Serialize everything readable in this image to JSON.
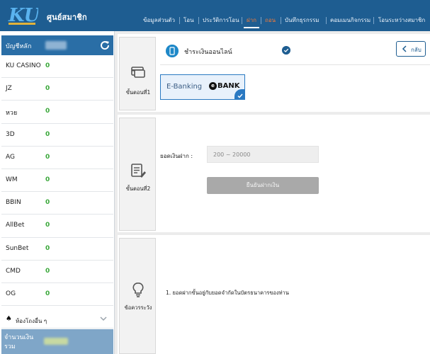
{
  "header": {
    "logo_text": "KU",
    "site_title": "ศูนย์สมาชิก",
    "nav": [
      {
        "label": "ข้อมูลส่วนตัว",
        "active": false
      },
      {
        "label": "โอน",
        "active": false
      },
      {
        "label": "ประวัติการโอน",
        "active": false
      },
      {
        "label": "ฝาก",
        "active": true
      },
      {
        "label": "ถอน",
        "active": false
      },
      {
        "label": "บันทึกธุรกรรม",
        "active": false
      },
      {
        "label": "คอมเมนกิจกรรม",
        "active": false
      },
      {
        "label": "โอนระหว่างสมาชิก",
        "active": false
      }
    ]
  },
  "sidebar": {
    "title": "บัญชีหลัก",
    "accounts": [
      {
        "name": "KU CASINO",
        "value": "0"
      },
      {
        "name": "JZ",
        "value": "0"
      },
      {
        "name": "หวย",
        "value": "0"
      },
      {
        "name": "3D",
        "value": "0"
      },
      {
        "name": "AG",
        "value": "0"
      },
      {
        "name": "WM",
        "value": "0"
      },
      {
        "name": "BBIN",
        "value": "0"
      },
      {
        "name": "AllBet",
        "value": "0"
      },
      {
        "name": "SunBet",
        "value": "0"
      },
      {
        "name": "CMD",
        "value": "0"
      },
      {
        "name": "OG",
        "value": "0"
      }
    ],
    "more_label": "ห้องโถงอื่น ๆ",
    "total_label": "จำนวนเงินรวม"
  },
  "steps": [
    {
      "label": "ขั้นตอนที่1",
      "icon": "card-icon"
    },
    {
      "label": "ขั้นตอนที่2",
      "icon": "form-icon"
    },
    {
      "label": "ข้อควรระวัง",
      "icon": "lightbulb-icon"
    }
  ],
  "panel": {
    "title": "ชำระเงินออนไลน์",
    "back_label": "กลับ"
  },
  "ebanking": {
    "label": "E-Banking",
    "brand": "BANK",
    "brand_prefix": "e"
  },
  "deposit": {
    "amount_label": "ยอดเงินฝาก :",
    "amount_placeholder": "200 ~ 20000",
    "confirm_label": "ยืนยันฝากเงิน"
  },
  "notes": [
    "1.  ยอดฝากขั้นอยู่กับยอดจำกัดในบัตรธนาคารของท่าน"
  ],
  "colors": {
    "header_bg": "#1e5d91",
    "active_nav": "#f07a3a",
    "balance_green": "#3aa83a"
  }
}
